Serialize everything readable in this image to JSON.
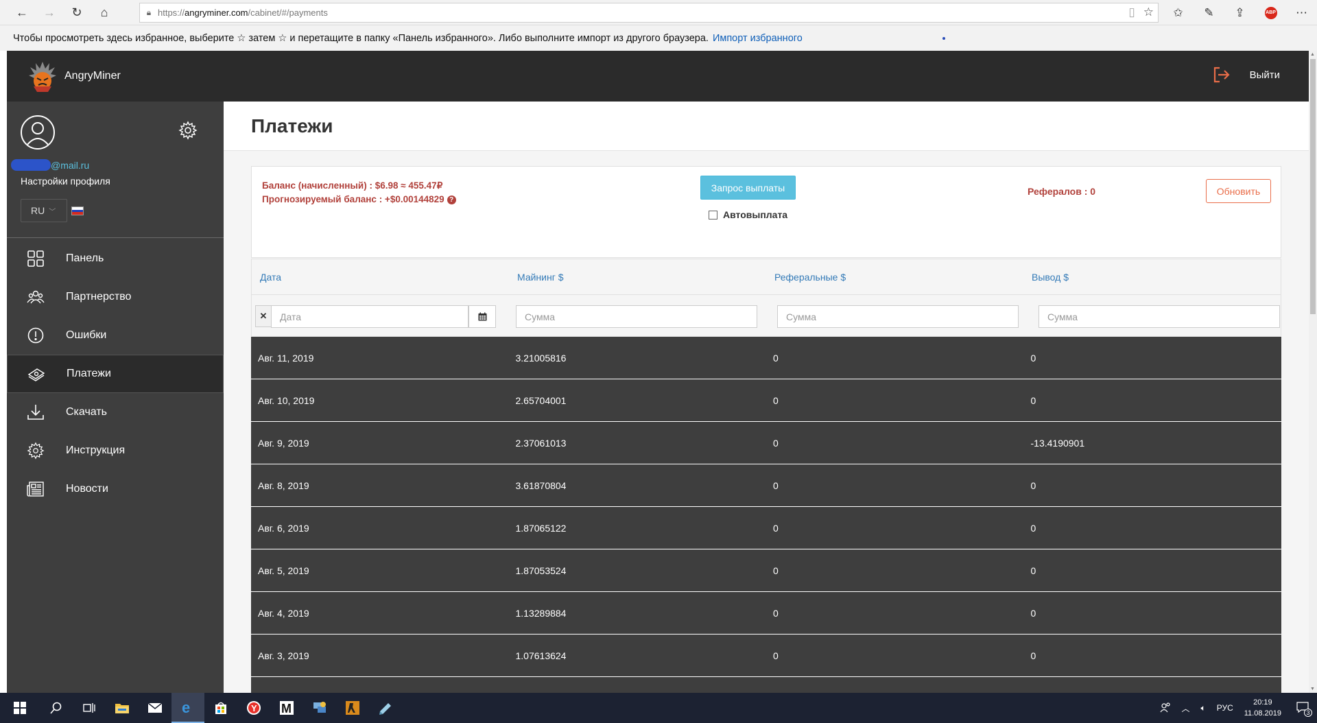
{
  "browser": {
    "url_scheme": "https://",
    "url_host": "angryminer.com",
    "url_path": "/cabinet/#/payments",
    "favorites_text": "Чтобы просмотреть здесь избранное, выберите ☆ затем ☆ и перетащите в папку «Панель избранного». Либо выполните импорт из другого браузера.",
    "favorites_link": "Импорт избранного"
  },
  "topbar": {
    "brand": "AngryMiner",
    "logout_label": "Выйти"
  },
  "sidebar": {
    "email_suffix": "@mail.ru",
    "profile_settings": "Настройки профиля",
    "language": "RU",
    "menu": [
      {
        "label": "Панель",
        "icon": "grid-icon"
      },
      {
        "label": "Партнерство",
        "icon": "partners-icon"
      },
      {
        "label": "Ошибки",
        "icon": "alert-icon"
      },
      {
        "label": "Платежи",
        "icon": "money-icon",
        "active": true
      },
      {
        "label": "Скачать",
        "icon": "download-icon"
      },
      {
        "label": "Инструкция",
        "icon": "gear-icon"
      },
      {
        "label": "Новости",
        "icon": "news-icon"
      }
    ]
  },
  "main": {
    "title": "Платежи",
    "balance_accrued": "Баланс (начисленный) : $6.98 ≈ 455.47₽",
    "balance_forecast": "Прогнозируемый баланс : +$0.00144829",
    "payout_button": "Запрос выплаты",
    "autopayout_label": "Автовыплата",
    "referrals": "Рефералов : 0",
    "refresh_button": "Обновить",
    "table": {
      "headers": [
        "Дата",
        "Майнинг $",
        "Реферальные $",
        "Вывод $"
      ],
      "date_placeholder": "Дата",
      "sum_placeholder": "Сумма",
      "rows": [
        [
          "Авг. 11, 2019",
          "3.21005816",
          "0",
          "0"
        ],
        [
          "Авг. 10, 2019",
          "2.65704001",
          "0",
          "0"
        ],
        [
          "Авг. 9, 2019",
          "2.37061013",
          "0",
          "-13.4190901"
        ],
        [
          "Авг. 8, 2019",
          "3.61870804",
          "0",
          "0"
        ],
        [
          "Авг. 6, 2019",
          "1.87065122",
          "0",
          "0"
        ],
        [
          "Авг. 5, 2019",
          "1.87053524",
          "0",
          "0"
        ],
        [
          "Авг. 4, 2019",
          "1.13289884",
          "0",
          "0"
        ],
        [
          "Авг. 3, 2019",
          "1.07613624",
          "0",
          "0"
        ]
      ]
    }
  },
  "taskbar": {
    "language": "РУС",
    "time": "20:19",
    "date": "11.08.2019",
    "notifications": "3"
  },
  "colors": {
    "accent_red": "#b1413b",
    "info_button": "#5bc0de",
    "refresh_orange": "#e96d49",
    "sidebar_bg": "#3e3e3e",
    "topbar_bg": "#2b2b2b"
  }
}
